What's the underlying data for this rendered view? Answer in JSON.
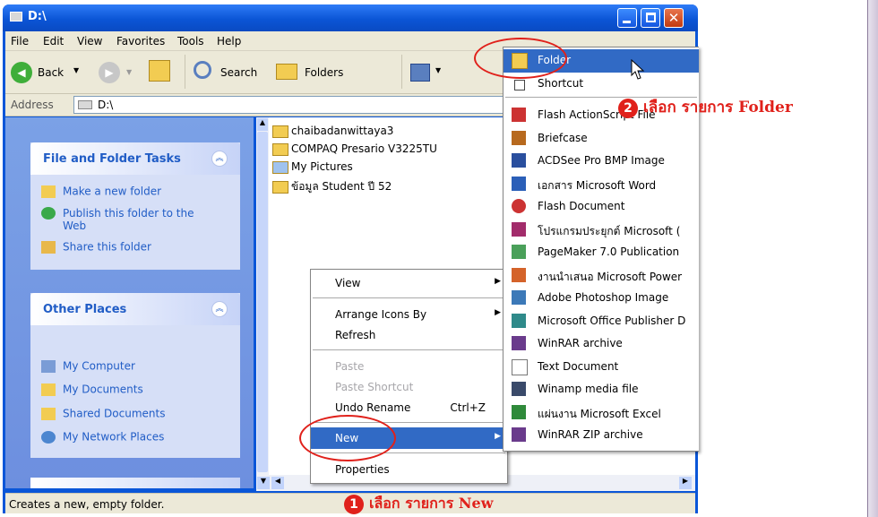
{
  "window": {
    "title": "D:\\"
  },
  "menubar": [
    "File",
    "Edit",
    "View",
    "Favorites",
    "Tools",
    "Help"
  ],
  "toolbar": {
    "back": "Back",
    "search": "Search",
    "folders": "Folders"
  },
  "address": {
    "label": "Address",
    "value": "D:\\"
  },
  "left_pane": {
    "file_tasks": {
      "title": "File and Folder Tasks",
      "items": [
        "Make a new folder",
        "Publish this folder to the Web",
        "Share this folder"
      ]
    },
    "other_places": {
      "title": "Other Places",
      "items": [
        "My Computer",
        "My Documents",
        "Shared Documents",
        "My Network Places"
      ]
    }
  },
  "files": [
    "chaibadanwittaya3",
    "COMPAQ Presario V3225TU",
    "My Pictures",
    "ข้อมูล Student ปี 52"
  ],
  "context_menu": {
    "view": "View",
    "arrange": "Arrange Icons By",
    "refresh": "Refresh",
    "paste": "Paste",
    "paste_shortcut": "Paste Shortcut",
    "undo": "Undo Rename",
    "undo_shortcut": "Ctrl+Z",
    "new": "New",
    "properties": "Properties"
  },
  "new_submenu": [
    "Folder",
    "Shortcut",
    "Flash ActionScript File",
    "Briefcase",
    "ACDSee Pro BMP Image",
    "เอกสาร Microsoft Word",
    "Flash Document",
    "โปรแกรมประยุกต์ Microsoft (",
    "PageMaker 7.0 Publication",
    "งานนำเสนอ Microsoft Power",
    "Adobe Photoshop Image",
    "Microsoft Office Publisher D",
    "WinRAR archive",
    "Text Document",
    "Winamp media file",
    "แผ่นงาน Microsoft Excel",
    "WinRAR ZIP archive"
  ],
  "status": "Creates a new, empty folder.",
  "annotations": {
    "step1_num": "1",
    "step1_text": "เลือก  รายการ  New",
    "step2_num": "2",
    "step2_text": "เลือก  รายการ  Folder"
  },
  "colors": {
    "xp_blue": "#0a56d8",
    "selection": "#316ac5",
    "annotation_red": "#e0211b"
  }
}
